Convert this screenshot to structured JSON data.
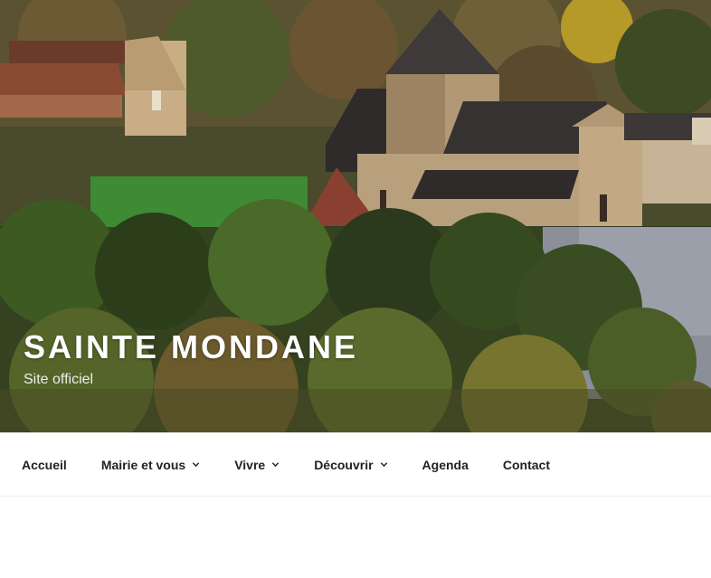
{
  "site": {
    "title": "SAINTE MONDANE",
    "description": "Site officiel"
  },
  "header_image": {
    "icon": "village-church-landscape-image"
  },
  "menu": {
    "items": [
      {
        "label": "Accueil",
        "has_submenu": false
      },
      {
        "label": "Mairie et vous",
        "has_submenu": true
      },
      {
        "label": "Vivre",
        "has_submenu": true
      },
      {
        "label": "Découvrir",
        "has_submenu": true
      },
      {
        "label": "Agenda",
        "has_submenu": false
      },
      {
        "label": "Contact",
        "has_submenu": false
      }
    ]
  },
  "colors": {
    "title": "#ffffff",
    "menu_text": "#222222",
    "background": "#ffffff"
  }
}
